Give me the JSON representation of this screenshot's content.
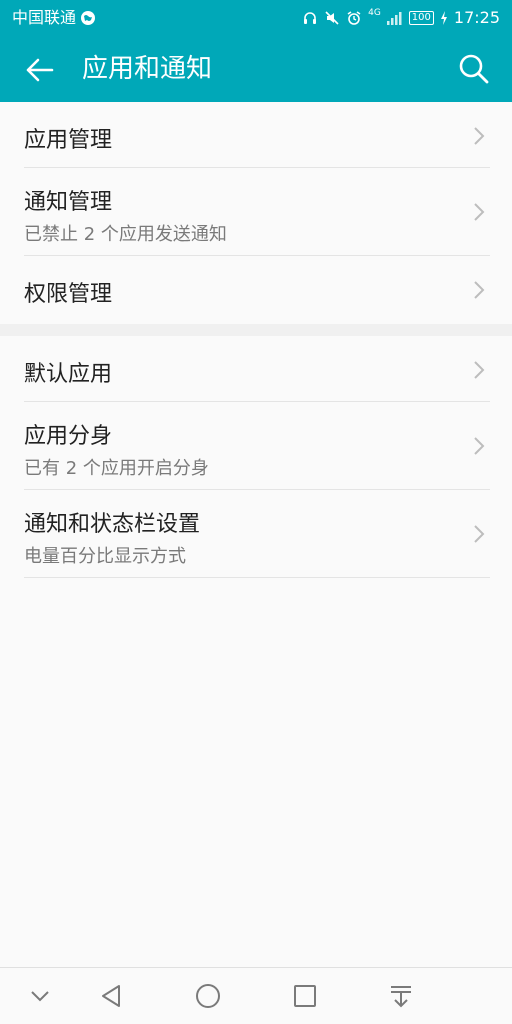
{
  "status_bar": {
    "carrier": "中国联通",
    "network": "4G",
    "battery": "100",
    "time": "17:25"
  },
  "app_bar": {
    "title": "应用和通知"
  },
  "groups": [
    {
      "items": [
        {
          "title": "应用管理",
          "subtitle": ""
        },
        {
          "title": "通知管理",
          "subtitle": "已禁止 2 个应用发送通知"
        },
        {
          "title": "权限管理",
          "subtitle": ""
        }
      ]
    },
    {
      "items": [
        {
          "title": "默认应用",
          "subtitle": ""
        },
        {
          "title": "应用分身",
          "subtitle": "已有 2 个应用开启分身"
        },
        {
          "title": "通知和状态栏设置",
          "subtitle": "电量百分比显示方式"
        }
      ]
    }
  ],
  "colors": {
    "accent": "#00a8b8",
    "background": "#fafafa",
    "title_text": "#222222",
    "subtitle_text": "#7a7a7a"
  },
  "icons": {
    "back": "arrow-left-icon",
    "search": "search-icon",
    "chevron": "chevron-right-icon",
    "nav": [
      "chevron-down-icon",
      "back-triangle-icon",
      "home-circle-icon",
      "recents-square-icon",
      "notification-pull-icon"
    ]
  }
}
